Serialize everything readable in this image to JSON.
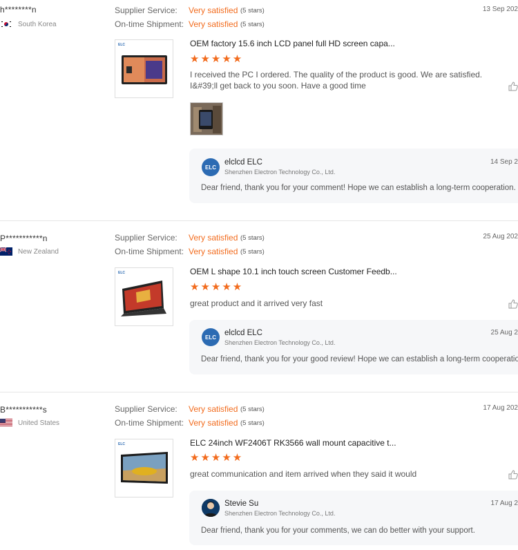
{
  "labels": {
    "supplier_service": "Supplier Service:",
    "on_time_shipment": "On-time Shipment:"
  },
  "reviews": [
    {
      "user": "h********n",
      "country": "South Korea",
      "supplier_value": "Very satisfied",
      "supplier_stars": "(5 stars)",
      "shipment_value": "Very satisfied",
      "shipment_stars": "(5 stars)",
      "date": "13 Sep 202",
      "product_title": "OEM factory 15.6 inch LCD panel full HD screen capa...",
      "rating_stars": "★★★★★",
      "rating": 5,
      "comment": "I received the PC I ordered. The quality of the product is good. We are satisfied. I&#39;ll get back to you soon. Have a good time",
      "reply": {
        "name": "elclcd ELC",
        "company": "Shenzhen Electron Technology Co., Ltd.",
        "date": "14 Sep 2",
        "text": "Dear friend, thank you for your comment! Hope we can establish a long-term cooperation."
      }
    },
    {
      "user": "P***********n",
      "country": "New Zealand",
      "supplier_value": "Very satisfied",
      "supplier_stars": "(5 stars)",
      "shipment_value": "Very satisfied",
      "shipment_stars": "(5 stars)",
      "date": "25 Aug 202",
      "product_title": "OEM L shape 10.1 inch touch screen Customer Feedb...",
      "rating_stars": "★★★★★",
      "rating": 5,
      "comment": "great product and it arrived very fast",
      "reply": {
        "name": "elclcd ELC",
        "company": "Shenzhen Electron Technology Co., Ltd.",
        "date": "25 Aug 2",
        "text": "Dear friend, thank you for your good review! Hope we can establish a long-term cooperation"
      }
    },
    {
      "user": "B***********s",
      "country": "United States",
      "supplier_value": "Very satisfied",
      "supplier_stars": "(5 stars)",
      "shipment_value": "Very satisfied",
      "shipment_stars": "(5 stars)",
      "date": "17 Aug 202",
      "product_title": "ELC 24inch WF2406T RK3566 wall mount capacitive t...",
      "rating_stars": "★★★★★",
      "rating": 5,
      "comment": "great communication and item arrived when they said it would",
      "reply": {
        "name": "Stevie Su",
        "company": "Shenzhen Electron Technology Co., Ltd.",
        "date": "17 Aug 2",
        "text": "Dear friend, thank you for your comments, we can do better with your support."
      }
    }
  ],
  "logo_text": "ELC",
  "colors": {
    "accent": "#f26b1d",
    "brand": "#2c6bb3",
    "reply_bg": "#f6f7f9"
  },
  "icons": {
    "like": "thumbs-up-icon"
  }
}
